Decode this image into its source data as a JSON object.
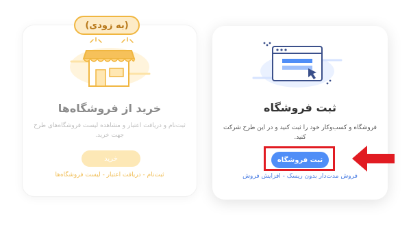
{
  "cards": {
    "buy": {
      "badge": "(به زودی)",
      "title": "خرید از فروشگاه‌ها",
      "description": "ثبت‌نام و دریافت اعتبار و مشاهده لیست فروشگاه‌های طرح جهت خرید.",
      "button": "خرید",
      "footnote": "ثبت‌نام - دریافت اعتبار - لیست فروشگاه‌ها",
      "icon": "storefront-icon"
    },
    "register": {
      "title": "ثبت فروشگاه",
      "description": "فروشگاه و کسب‌وکار خود را ثبت کنید و در این طرح شرکت کنید.",
      "button": "ثبت فروشگاه",
      "footnote": "فروش مدت‌دار بدون ریسک - افزایش فروش",
      "icon": "browser-window-icon"
    }
  },
  "annotation": {
    "highlight_color": "#e11b22",
    "arrow_icon": "left-pointing-arrow-icon"
  },
  "colors": {
    "accent_blue": "#4f8ef7",
    "accent_yellow": "#f0b640"
  }
}
